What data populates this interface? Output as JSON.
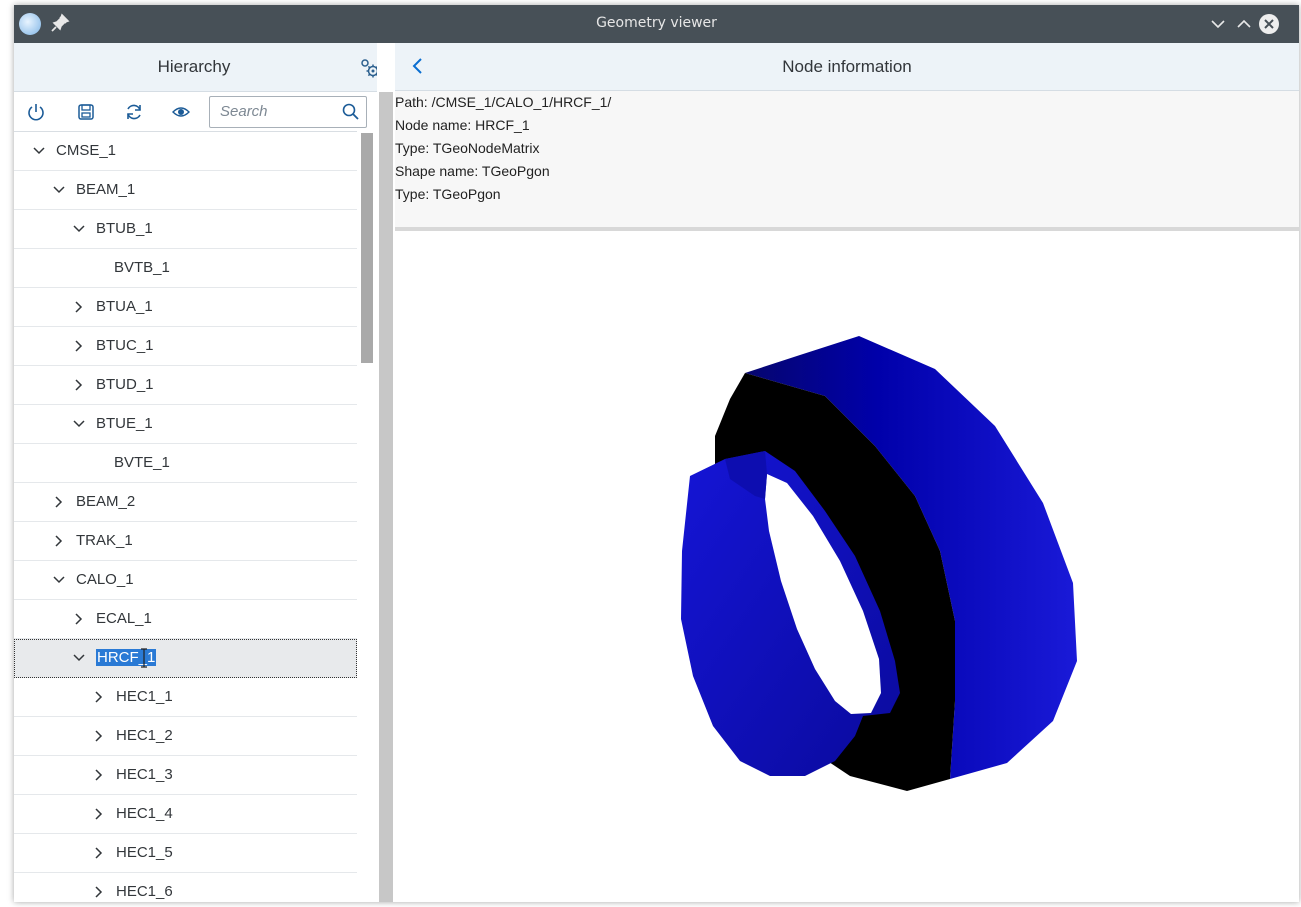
{
  "window": {
    "title": "Geometry viewer"
  },
  "hierarchy": {
    "title": "Hierarchy",
    "search": {
      "placeholder": "Search",
      "value": ""
    },
    "rows": [
      {
        "label": "CMSE_1",
        "level": 0,
        "expander": "expanded"
      },
      {
        "label": "BEAM_1",
        "level": 1,
        "expander": "expanded"
      },
      {
        "label": "BTUB_1",
        "level": 2,
        "expander": "expanded"
      },
      {
        "label": "BVTB_1",
        "level": 3,
        "expander": "none"
      },
      {
        "label": "BTUA_1",
        "level": 2,
        "expander": "collapsed"
      },
      {
        "label": "BTUC_1",
        "level": 2,
        "expander": "collapsed"
      },
      {
        "label": "BTUD_1",
        "level": 2,
        "expander": "collapsed"
      },
      {
        "label": "BTUE_1",
        "level": 2,
        "expander": "expanded"
      },
      {
        "label": "BVTE_1",
        "level": 3,
        "expander": "none"
      },
      {
        "label": "BEAM_2",
        "level": 1,
        "expander": "collapsed"
      },
      {
        "label": "TRAK_1",
        "level": 1,
        "expander": "collapsed"
      },
      {
        "label": "CALO_1",
        "level": 1,
        "expander": "expanded"
      },
      {
        "label": "ECAL_1",
        "level": 2,
        "expander": "collapsed"
      },
      {
        "label": "HRCF_1",
        "level": 2,
        "expander": "expanded",
        "selected": true
      },
      {
        "label": "HEC1_1",
        "level": 3,
        "expander": "collapsed"
      },
      {
        "label": "HEC1_2",
        "level": 3,
        "expander": "collapsed"
      },
      {
        "label": "HEC1_3",
        "level": 3,
        "expander": "collapsed"
      },
      {
        "label": "HEC1_4",
        "level": 3,
        "expander": "collapsed"
      },
      {
        "label": "HEC1_5",
        "level": 3,
        "expander": "collapsed"
      },
      {
        "label": "HEC1_6",
        "level": 3,
        "expander": "collapsed"
      }
    ]
  },
  "node_info": {
    "title": "Node information",
    "path": "Path: /CMSE_1/CALO_1/HRCF_1/",
    "node_name": "Node name: HRCF_1",
    "type": "Type: TGeoNodeMatrix",
    "shape_name": "Shape name: TGeoPgon",
    "shape_type": "Type: TGeoPgon"
  },
  "colors": {
    "titlebar": "#475057",
    "header_bg": "#edf3f8",
    "accent": "#0a6ed1",
    "selection": "#2a7ad5",
    "shape_blue": "#1414d2",
    "shape_dark": "#000000"
  },
  "icons": {
    "app": "root-app-icon",
    "pin": "pin-icon",
    "settings": "settings-icon",
    "power": "power-icon",
    "save": "save-icon",
    "reload": "reload-icon",
    "visibility": "eye-icon",
    "search": "search-icon",
    "back": "back-icon"
  }
}
